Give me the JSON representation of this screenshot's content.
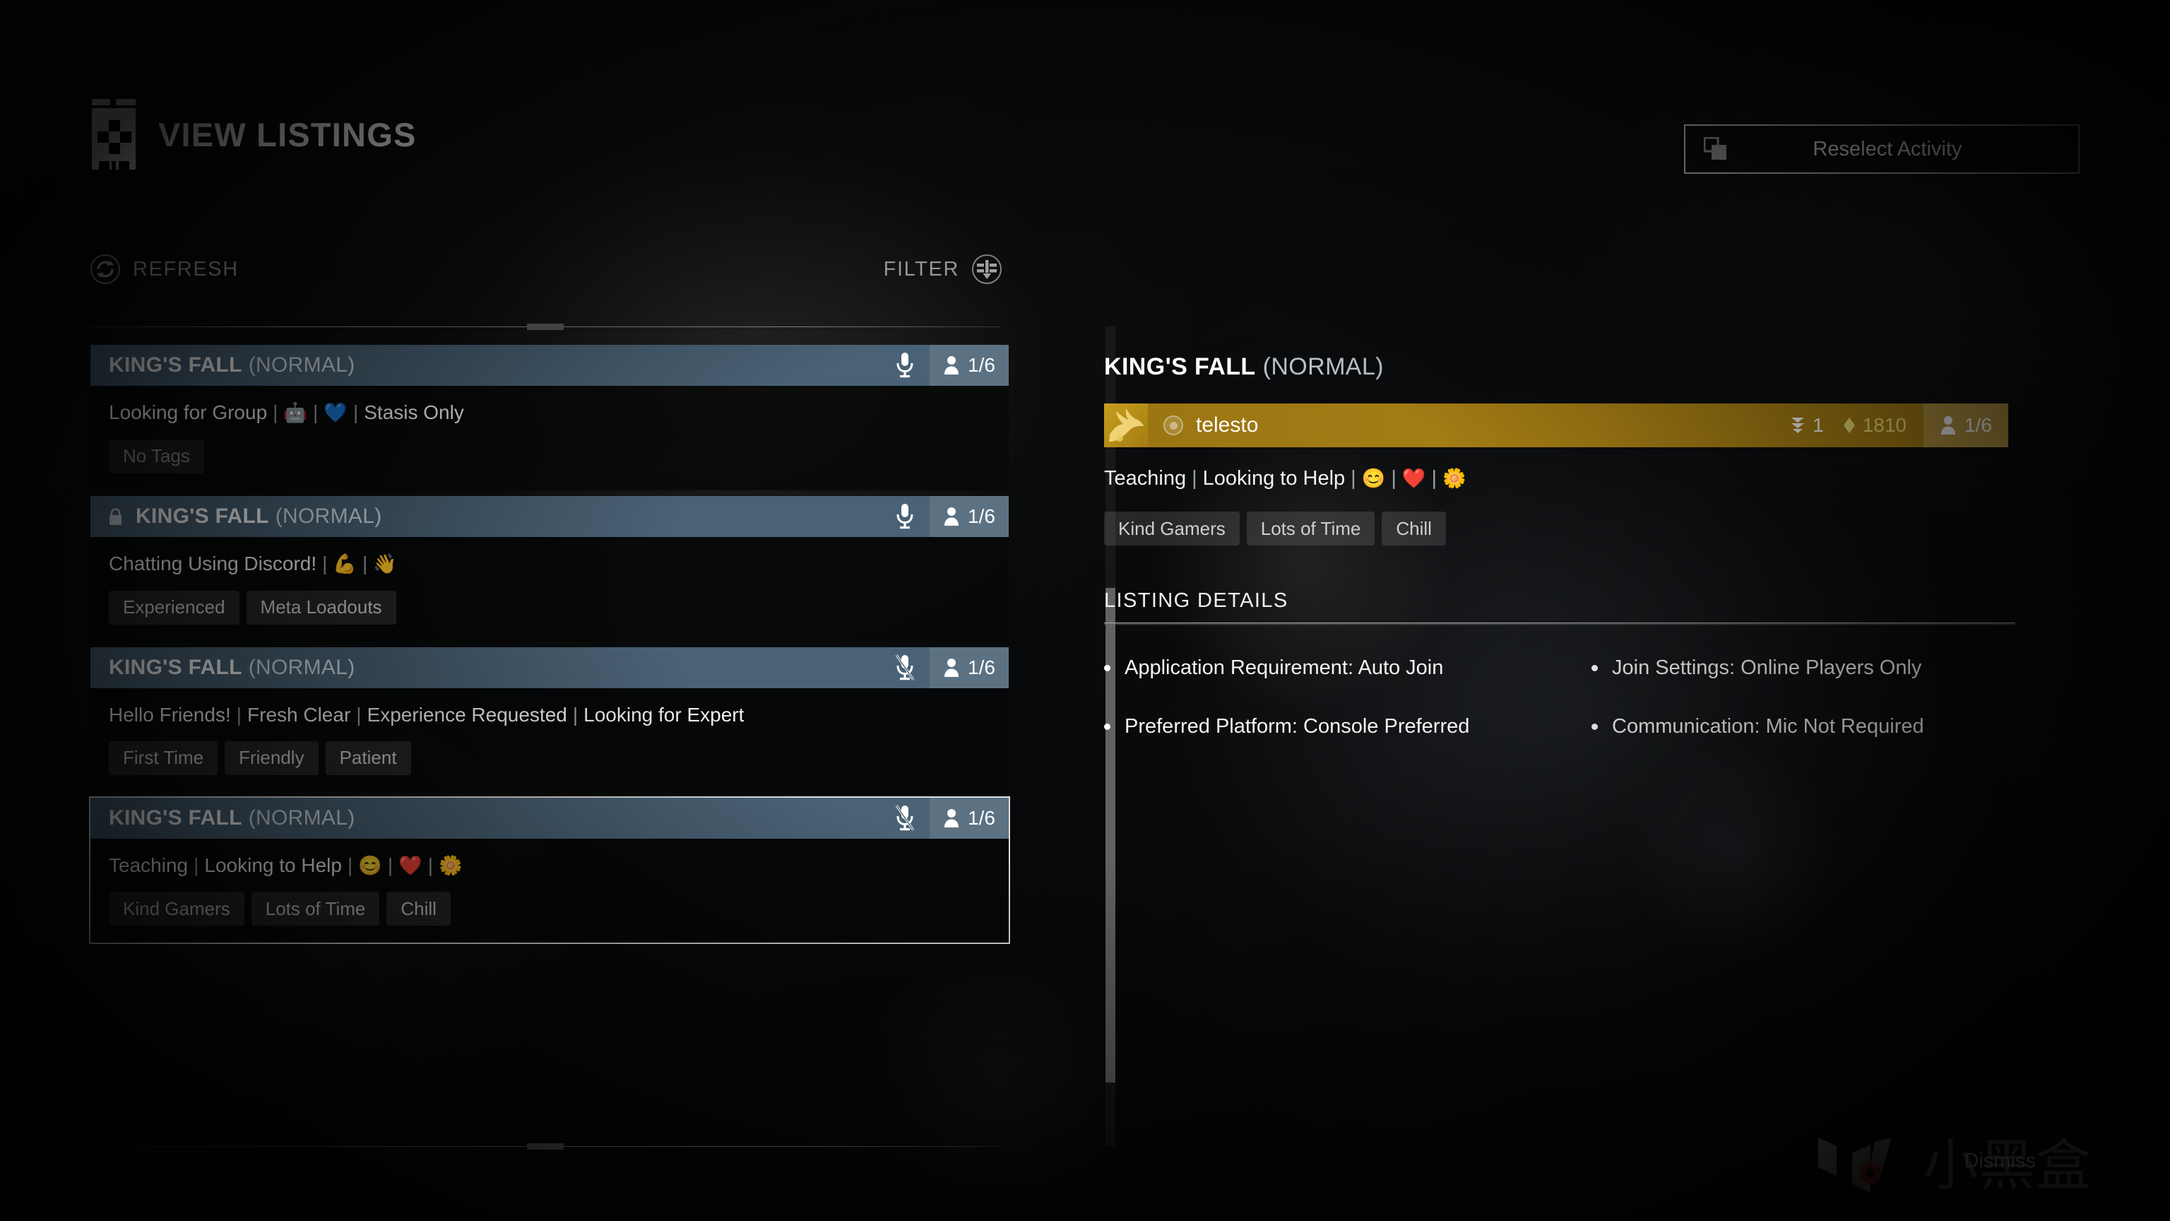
{
  "header": {
    "title": "VIEW LISTINGS",
    "glyph_icon": "listings-grid-icon",
    "reselect": {
      "label": "Reselect Activity",
      "icon": "copy-windows-icon"
    }
  },
  "toolbar": {
    "refresh": {
      "label": "REFRESH",
      "icon": "refresh-circle-icon"
    },
    "filter": {
      "label": "FILTER",
      "icon": "filter-circle-icon"
    }
  },
  "listings": [
    {
      "title": "KING'S FALL",
      "mode": "(NORMAL)",
      "locked": false,
      "lock_icon": "lock-icon",
      "mic": "mic-on-icon",
      "mic_muted": false,
      "fireteam_icon": "person-icon",
      "fireteam": "1/6",
      "description_parts": [
        "Looking for Group",
        "|",
        "🤖",
        "|",
        "💙",
        "|",
        "Stasis Only"
      ],
      "tags": [
        "No Tags"
      ],
      "tags_empty": true,
      "selected": false
    },
    {
      "title": "KING'S FALL",
      "mode": "(NORMAL)",
      "locked": true,
      "lock_icon": "lock-icon",
      "mic": "mic-on-icon",
      "mic_muted": false,
      "fireteam_icon": "person-icon",
      "fireteam": "1/6",
      "description_parts": [
        "Chatting Using Discord!",
        "|",
        "💪",
        "|",
        "👋"
      ],
      "tags": [
        "Experienced",
        "Meta Loadouts"
      ],
      "tags_empty": false,
      "selected": false
    },
    {
      "title": "KING'S FALL",
      "mode": "(NORMAL)",
      "locked": false,
      "lock_icon": "lock-icon",
      "mic": "mic-off-icon",
      "mic_muted": true,
      "fireteam_icon": "person-icon",
      "fireteam": "1/6",
      "description_parts": [
        "Hello Friends!",
        "|",
        "Fresh Clear",
        "|",
        "Experience Requested",
        "|",
        "Looking for Expert"
      ],
      "tags": [
        "First Time",
        "Friendly",
        "Patient"
      ],
      "tags_empty": false,
      "selected": false
    },
    {
      "title": "KING'S FALL",
      "mode": "(NORMAL)",
      "locked": false,
      "lock_icon": "lock-icon",
      "mic": "mic-off-icon",
      "mic_muted": true,
      "fireteam_icon": "person-icon",
      "fireteam": "1/6",
      "description_parts": [
        "Teaching",
        "|",
        "Looking to Help",
        "|",
        "😊",
        "|",
        "❤️",
        "|",
        "🌼"
      ],
      "tags": [
        "Kind Gamers",
        "Lots of Time",
        "Chill"
      ],
      "tags_empty": false,
      "selected": true
    }
  ],
  "detail": {
    "title": "KING'S FALL",
    "mode": "(NORMAL)",
    "player": {
      "emblem_icon": "eagle-emblem-icon",
      "platform_icon": "platform-circle-icon",
      "name": "telesto",
      "rank_icon": "fireteam-rank-icon",
      "rank": "1",
      "power_icon": "power-diamond-icon",
      "power": "1810",
      "fireteam_icon": "person-icon",
      "fireteam": "1/6"
    },
    "description_parts": [
      "Teaching",
      "|",
      "Looking to Help",
      "|",
      "😊",
      "|",
      "❤️",
      "|",
      "🌼"
    ],
    "tags": [
      "Kind Gamers",
      "Lots of Time",
      "Chill"
    ],
    "details_heading": "LISTING DETAILS",
    "details": [
      "Application Requirement: Auto Join",
      "Join Settings: Online Players Only",
      "Preferred Platform: Console Preferred",
      "Communication: Mic Not Required"
    ]
  },
  "overlay": {
    "dismiss_label": "Dismiss",
    "watermark_text": "小黑盒"
  },
  "colors": {
    "card_header": "#4a6275",
    "player_row_gold": "#a77f14",
    "power_yellow": "#f5e27a",
    "selected_outline": "#dedede"
  }
}
